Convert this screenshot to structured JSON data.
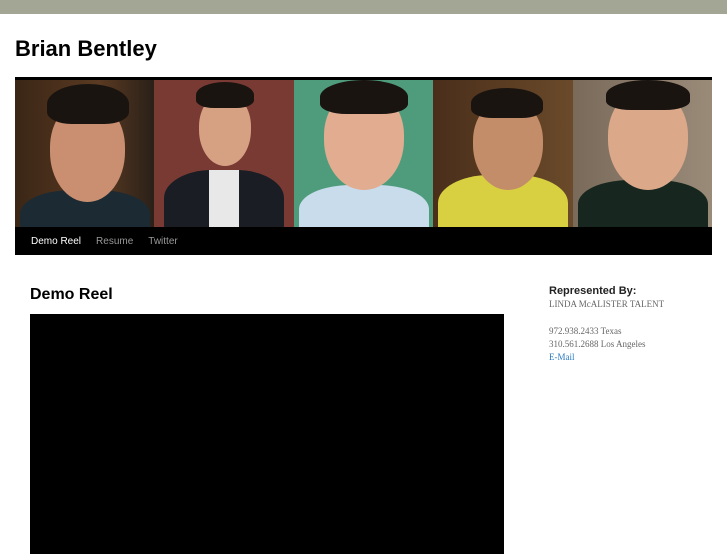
{
  "site": {
    "title": "Brian Bentley"
  },
  "nav": [
    {
      "label": "Demo Reel"
    },
    {
      "label": "Resume"
    },
    {
      "label": "Twitter"
    }
  ],
  "main": {
    "heading": "Demo Reel"
  },
  "sidebar": {
    "heading": "Represented By:",
    "agency": "LINDA McALISTER TALENT",
    "phone_texas": "972.938.2433 Texas",
    "phone_la": "310.561.2688 Los Angeles",
    "email_label": "E-Mail"
  },
  "colors": {
    "topbar": "#a3a595",
    "link": "#2a7ac0"
  }
}
